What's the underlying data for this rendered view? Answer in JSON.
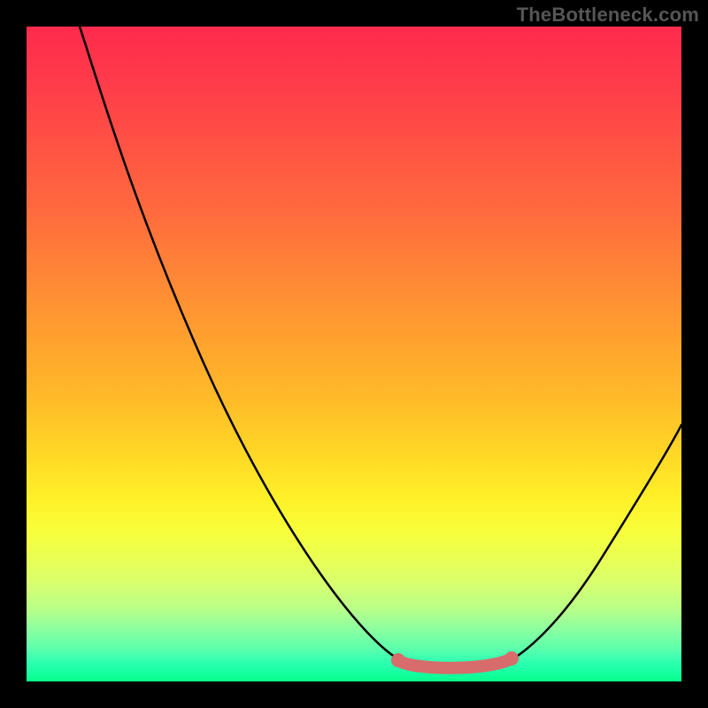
{
  "watermark": "TheBottleneck.com",
  "colors": {
    "curve": "#000000",
    "highlight": "#d86b6b",
    "gradient_top": "#ff2a4c",
    "gradient_mid": "#ffda26",
    "gradient_bottom": "#06ff88",
    "frame": "#000000"
  },
  "chart_data": {
    "type": "line",
    "title": "",
    "xlabel": "",
    "ylabel": "",
    "xlim": [
      0,
      100
    ],
    "ylim": [
      0,
      100
    ],
    "grid": false,
    "legend": false,
    "background": "vertical-heatmap-gradient",
    "series": [
      {
        "name": "bottleneck-curve",
        "x": [
          8,
          15,
          27,
          40,
          52,
          58,
          62,
          67,
          72,
          76,
          82,
          90,
          100
        ],
        "y": [
          100,
          88,
          62,
          38,
          14,
          4,
          2,
          2,
          2,
          4,
          12,
          30,
          40
        ]
      }
    ],
    "annotations": [
      {
        "name": "optimal-range-highlight",
        "x_range": [
          57,
          74
        ],
        "y": 2,
        "style": "thick-pink-segment-with-endpoints"
      }
    ]
  }
}
